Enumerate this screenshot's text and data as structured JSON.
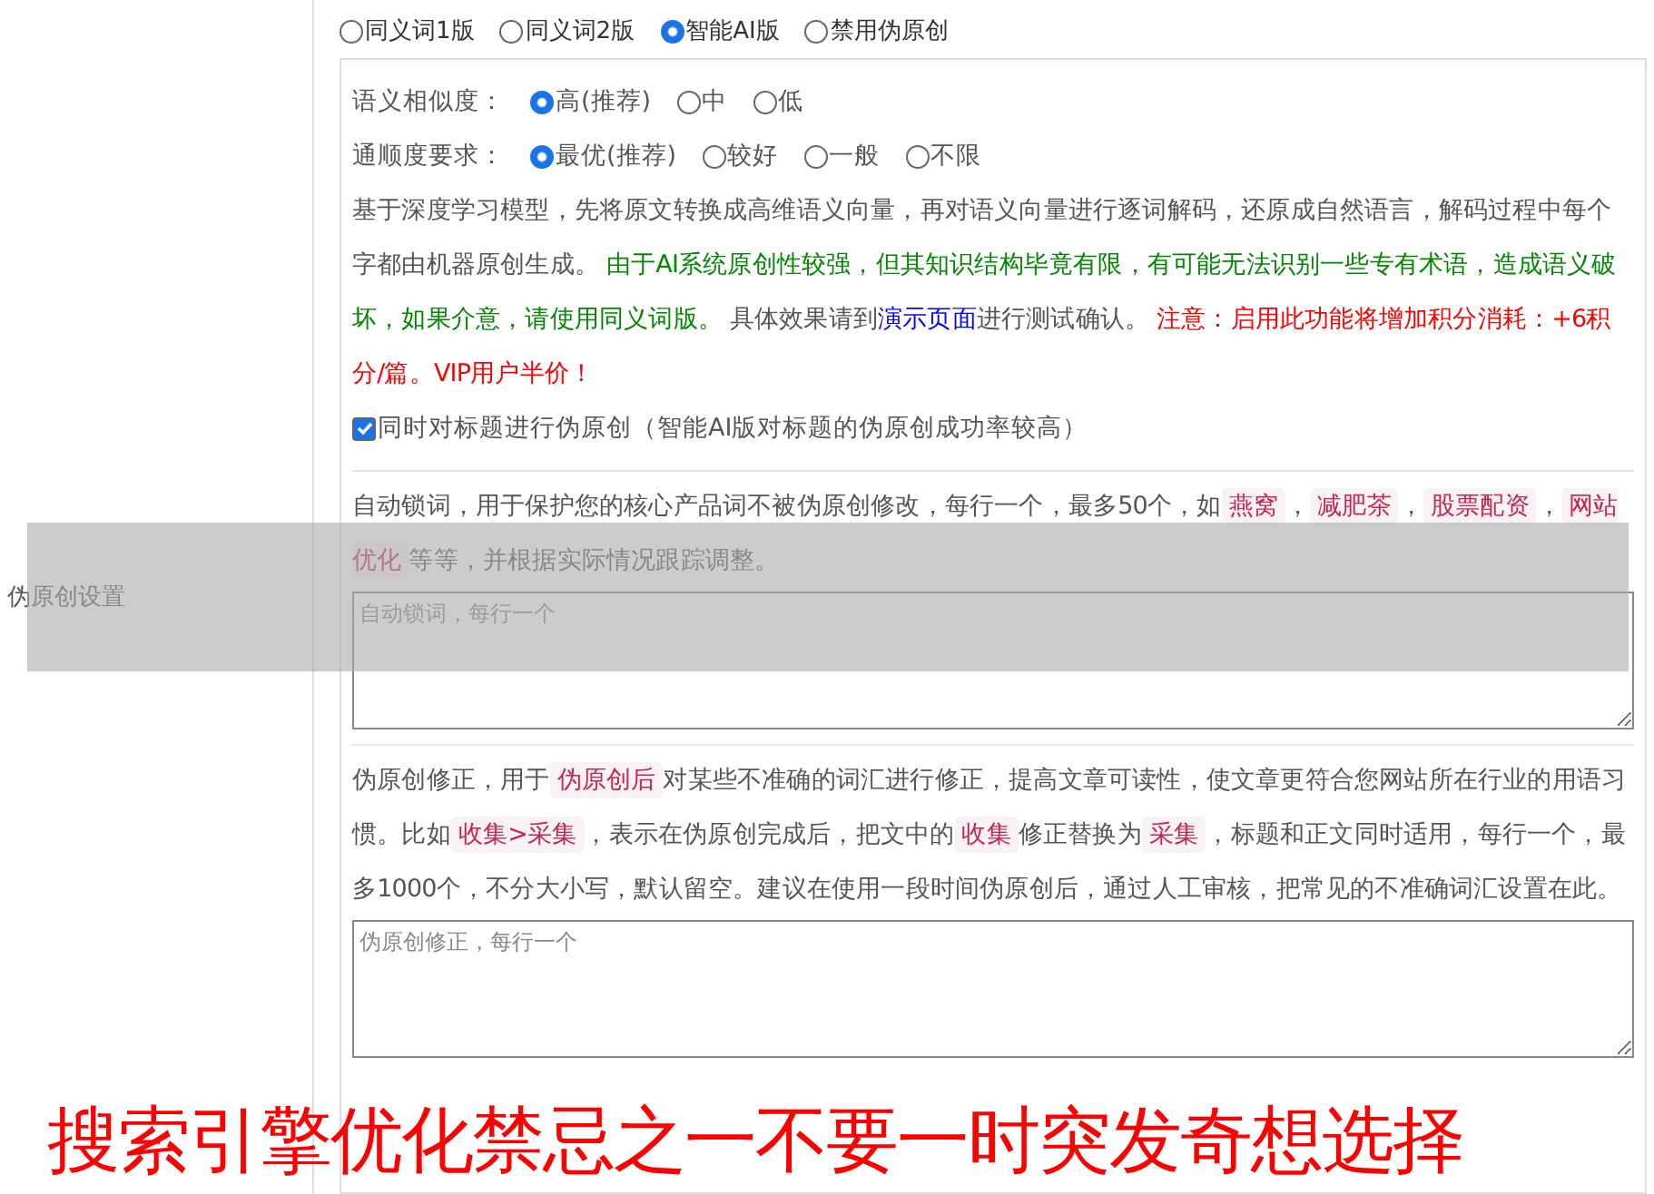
{
  "row_label": "伪原创设置",
  "modes": [
    {
      "label": "同义词1版",
      "selected": false
    },
    {
      "label": "同义词2版",
      "selected": false
    },
    {
      "label": "智能AI版",
      "selected": true
    },
    {
      "label": "禁用伪原创",
      "selected": false
    }
  ],
  "option_groups": [
    {
      "label": "语义相似度：",
      "options": [
        {
          "label": "高(推荐)",
          "selected": true
        },
        {
          "label": "中",
          "selected": false
        },
        {
          "label": "低",
          "selected": false
        }
      ]
    },
    {
      "label": "通顺度要求：",
      "options": [
        {
          "label": "最优(推荐)",
          "selected": true
        },
        {
          "label": "较好",
          "selected": false
        },
        {
          "label": "一般",
          "selected": false
        },
        {
          "label": "不限",
          "selected": false
        }
      ]
    }
  ],
  "ai_description": [
    {
      "kind": "plain",
      "text": "基于深度学习模型，先将原文转换成高维语义向量，再对语义向量进行逐词解码，还原成自然语言，解码过程中每个字都由机器原创生成。 "
    },
    {
      "kind": "green",
      "text": "由于AI系统原创性较强，但其知识结构毕竟有限，有可能无法识别一些专有术语，造成语义破坏，如果介意，请使用同义词版。"
    },
    {
      "kind": "plain",
      "text": " 具体效果请到"
    },
    {
      "kind": "link",
      "text": "演示页面"
    },
    {
      "kind": "plain",
      "text": "进行测试确认。 "
    },
    {
      "kind": "red",
      "text": "注意：启用此功能将增加积分消耗：+6积分/篇。VIP用户半价！"
    }
  ],
  "title_option": {
    "label": "同时对标题进行伪原创（智能AI版对标题的伪原创成功率较高）",
    "checked": true
  },
  "lock_words": {
    "description": [
      {
        "kind": "plain",
        "text": "自动锁词，用于保护您的核心产品词不被伪原创修改，每行一个，最多50个，如"
      },
      {
        "kind": "code",
        "text": "燕窝"
      },
      {
        "kind": "plain",
        "text": "，"
      },
      {
        "kind": "code",
        "text": "减肥茶"
      },
      {
        "kind": "plain",
        "text": "，"
      },
      {
        "kind": "code",
        "text": "股票配资"
      },
      {
        "kind": "plain",
        "text": "，"
      },
      {
        "kind": "code",
        "text": "网站优化"
      },
      {
        "kind": "plain",
        "text": "等等，并根据实际情况跟踪调整。"
      }
    ],
    "placeholder": "自动锁词，每行一个"
  },
  "corrections": {
    "description": [
      {
        "kind": "plain",
        "text": "伪原创修正，用于"
      },
      {
        "kind": "code",
        "text": "伪原创后"
      },
      {
        "kind": "plain",
        "text": "对某些不准确的词汇进行修正，提高文章可读性，使文章更符合您网站所在行业的用语习惯。比如"
      },
      {
        "kind": "code",
        "text": "收集>采集"
      },
      {
        "kind": "plain",
        "text": "，表示在伪原创完成后，把文中的"
      },
      {
        "kind": "code",
        "text": "收集"
      },
      {
        "kind": "plain",
        "text": "修正替换为"
      },
      {
        "kind": "code",
        "text": "采集"
      },
      {
        "kind": "plain",
        "text": "，标题和正文同时适用，每行一个，最多1000个，不分大小写，默认留空。建议在使用一段时间伪原创后，通过人工审核，把常见的不准确词汇设置在此。"
      }
    ],
    "placeholder": "伪原创修正，每行一个"
  },
  "caption": "搜索引擎优化禁忌之一不要一时突发奇想选择"
}
